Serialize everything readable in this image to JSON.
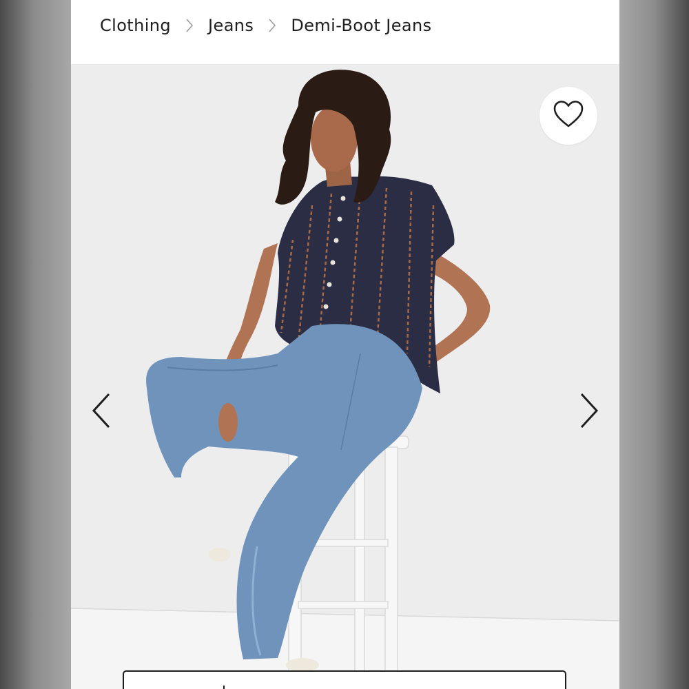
{
  "breadcrumb": {
    "items": [
      {
        "label": "Clothing"
      },
      {
        "label": "Jeans"
      },
      {
        "label": "Demi-Boot Jeans"
      }
    ]
  },
  "product_image": {
    "alt": "Demi-Boot Jeans",
    "shirt_color": "#2b2d45",
    "jeans_color": "#6f93bb",
    "background_color": "#ededee"
  },
  "actions": {
    "favorite_icon": "heart-outline-icon",
    "prev_icon": "chevron-left-icon",
    "next_icon": "chevron-right-icon"
  }
}
